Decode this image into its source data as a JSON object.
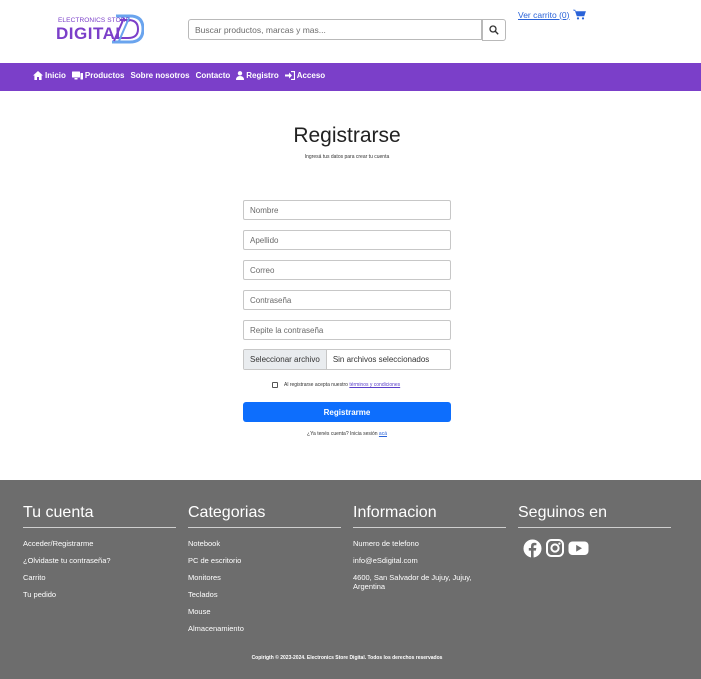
{
  "header": {
    "logo_small": "ELECTRONICS STORE",
    "logo_big": "DIGITAL",
    "search_placeholder": "Buscar productos, marcas y mas...",
    "cart_label": "Ver carrito (0)"
  },
  "nav": {
    "items": [
      {
        "label": "Inicio",
        "icon": "home-icon"
      },
      {
        "label": "Productos",
        "icon": "devices-icon"
      },
      {
        "label": "Sobre nosotros",
        "icon": ""
      },
      {
        "label": "Contacto",
        "icon": ""
      },
      {
        "label": "Registro",
        "icon": "user-icon"
      },
      {
        "label": "Acceso",
        "icon": "login-icon"
      }
    ]
  },
  "register": {
    "title": "Registrarse",
    "subtitle": "Ingresá tus datos para crear tu cuenta",
    "fields": {
      "nombre": "Nombre",
      "apellido": "Apellido",
      "correo": "Correo",
      "password": "Contraseña",
      "password_repeat": "Repite la contraseña"
    },
    "file_button": "Seleccionar archivo",
    "file_status": "Sin archivos seleccionados",
    "terms_prefix": "Al registrarse acepta nuestro",
    "terms_link": "términos y condiciones",
    "submit": "Registrarme",
    "login_prefix": "¿Ya tenés cuenta? Inicia sesión",
    "login_link": "acá"
  },
  "footer": {
    "cuenta": {
      "title": "Tu cuenta",
      "links": [
        "Acceder/Registrarme",
        "¿Olvidaste tu contraseña?",
        "Carrito",
        "Tu pedido"
      ]
    },
    "categorias": {
      "title": "Categorias",
      "links": [
        "Notebook",
        "PC de escritorio",
        "Monitores",
        "Teclados",
        "Mouse",
        "Almacenamiento"
      ]
    },
    "informacion": {
      "title": "Informacion",
      "links": [
        "Numero de telefono",
        "info@eSdigital.com",
        "4600, San Salvador de Jujuy, Jujuy, Argentina"
      ]
    },
    "social": {
      "title": "Seguinos en",
      "icons": [
        "facebook-icon",
        "instagram-icon",
        "youtube-icon"
      ]
    },
    "copyright": "Copirigth © 2023-2024. Electronics Store Digital. Todos los derechos reservados"
  },
  "colors": {
    "brand_purple": "#7b3fc9",
    "primary_blue": "#0d6efd",
    "footer_gray": "#6d6d6d"
  }
}
